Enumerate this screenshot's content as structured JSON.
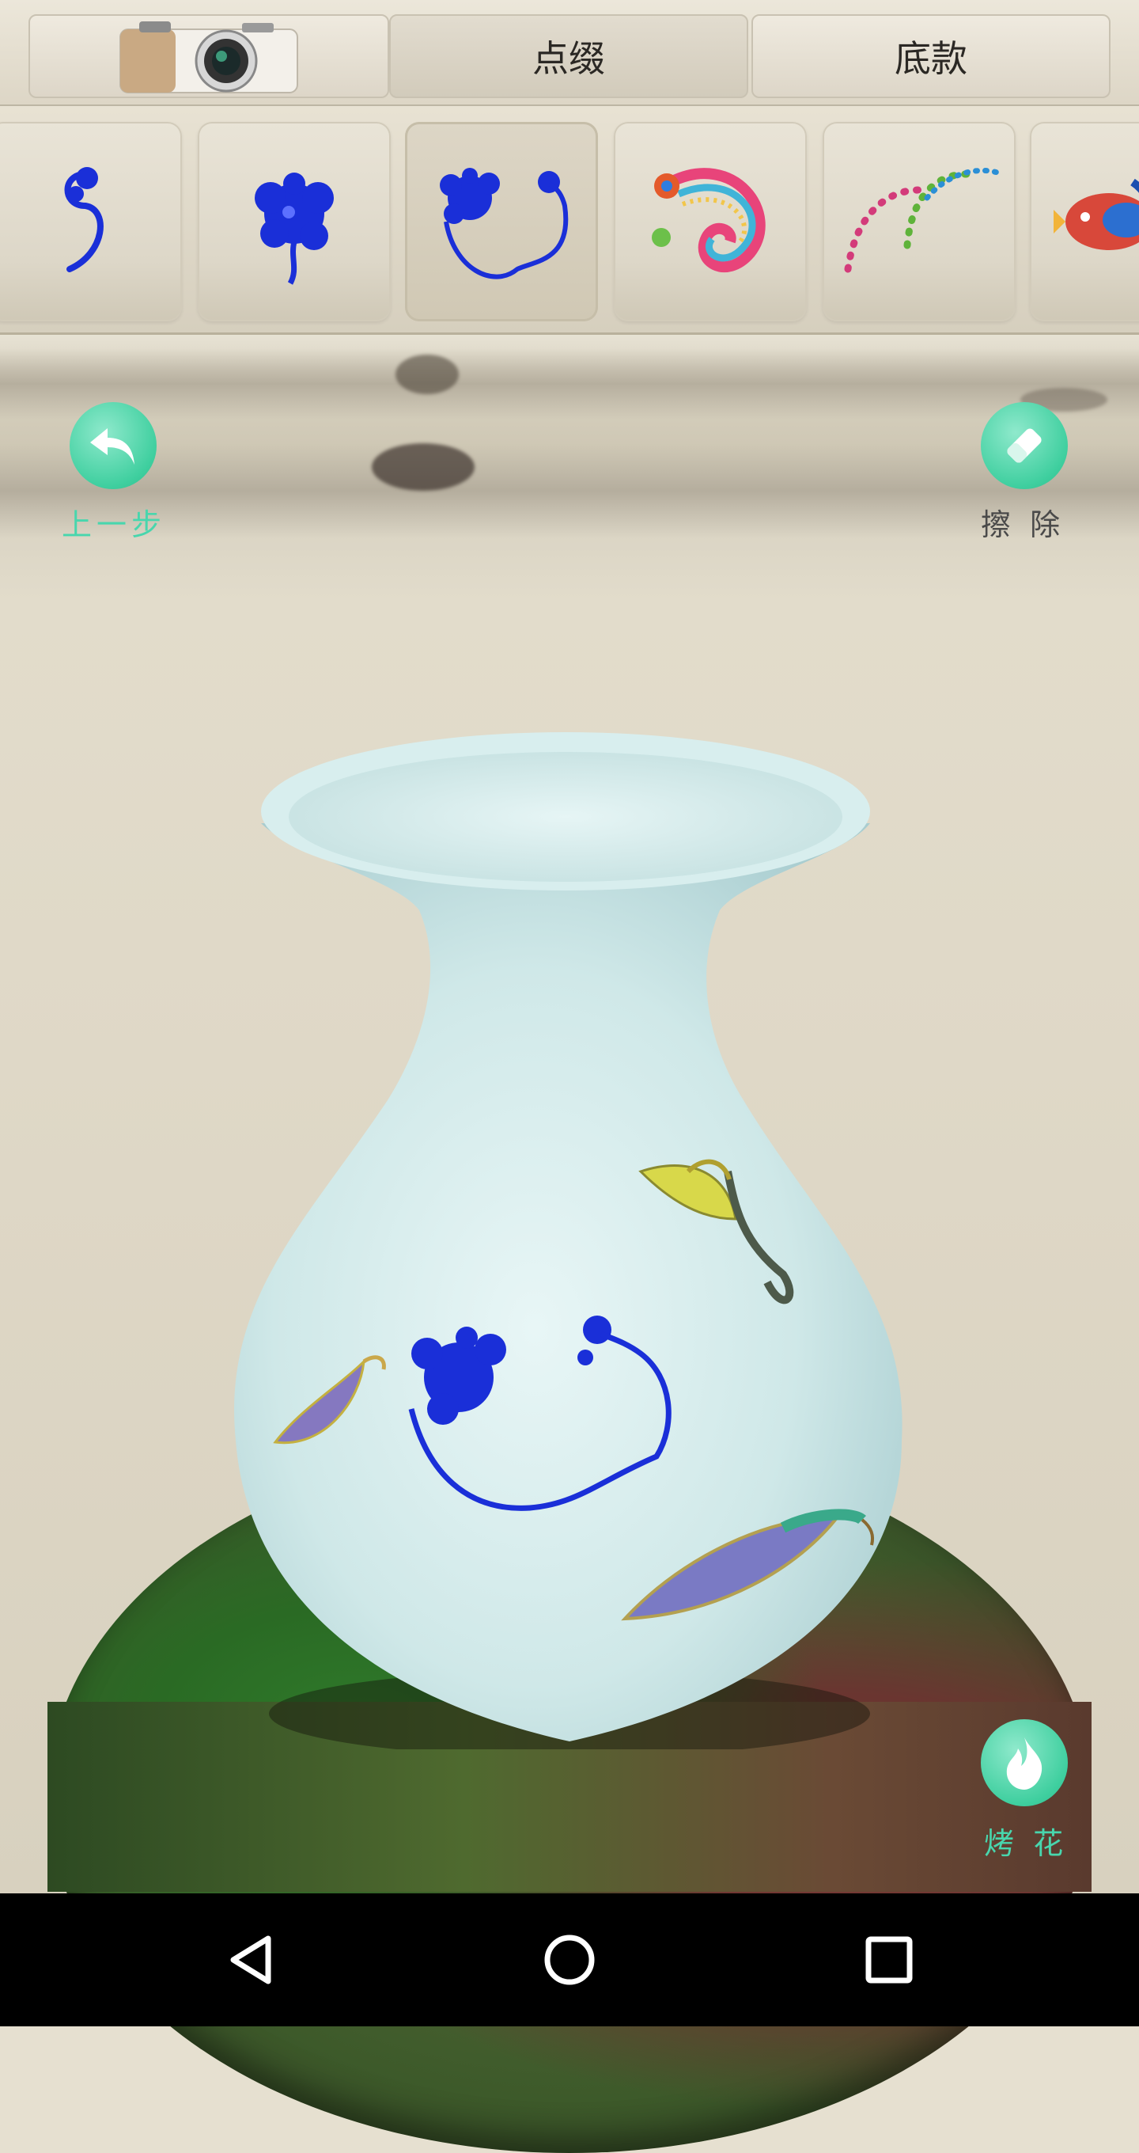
{
  "tabs": [
    {
      "id": "camera",
      "icon": "camera-icon"
    },
    {
      "id": "dianzhui",
      "label": "点缀"
    },
    {
      "id": "dikuan",
      "label": "底款"
    }
  ],
  "pattern_strip": {
    "tiles": [
      {
        "icon": "blue-scroll-small-icon"
      },
      {
        "icon": "blue-flower-icon"
      },
      {
        "icon": "blue-flower-scroll-icon",
        "selected": true
      },
      {
        "icon": "colorful-paisley-icon"
      },
      {
        "icon": "dotted-arc-icon"
      },
      {
        "icon": "fish-pattern-icon"
      }
    ]
  },
  "actions": {
    "undo_label": "上一步",
    "erase_label": "擦 除",
    "fire_label": "烤 花"
  },
  "colors": {
    "accent": "#3fcf9f",
    "accent_text": "#48d6ad",
    "dark_text": "#4a4a4a",
    "pattern_blue": "#1a2fd8"
  },
  "navbar": {
    "keys": [
      "back-icon",
      "home-icon",
      "recents-icon"
    ]
  }
}
